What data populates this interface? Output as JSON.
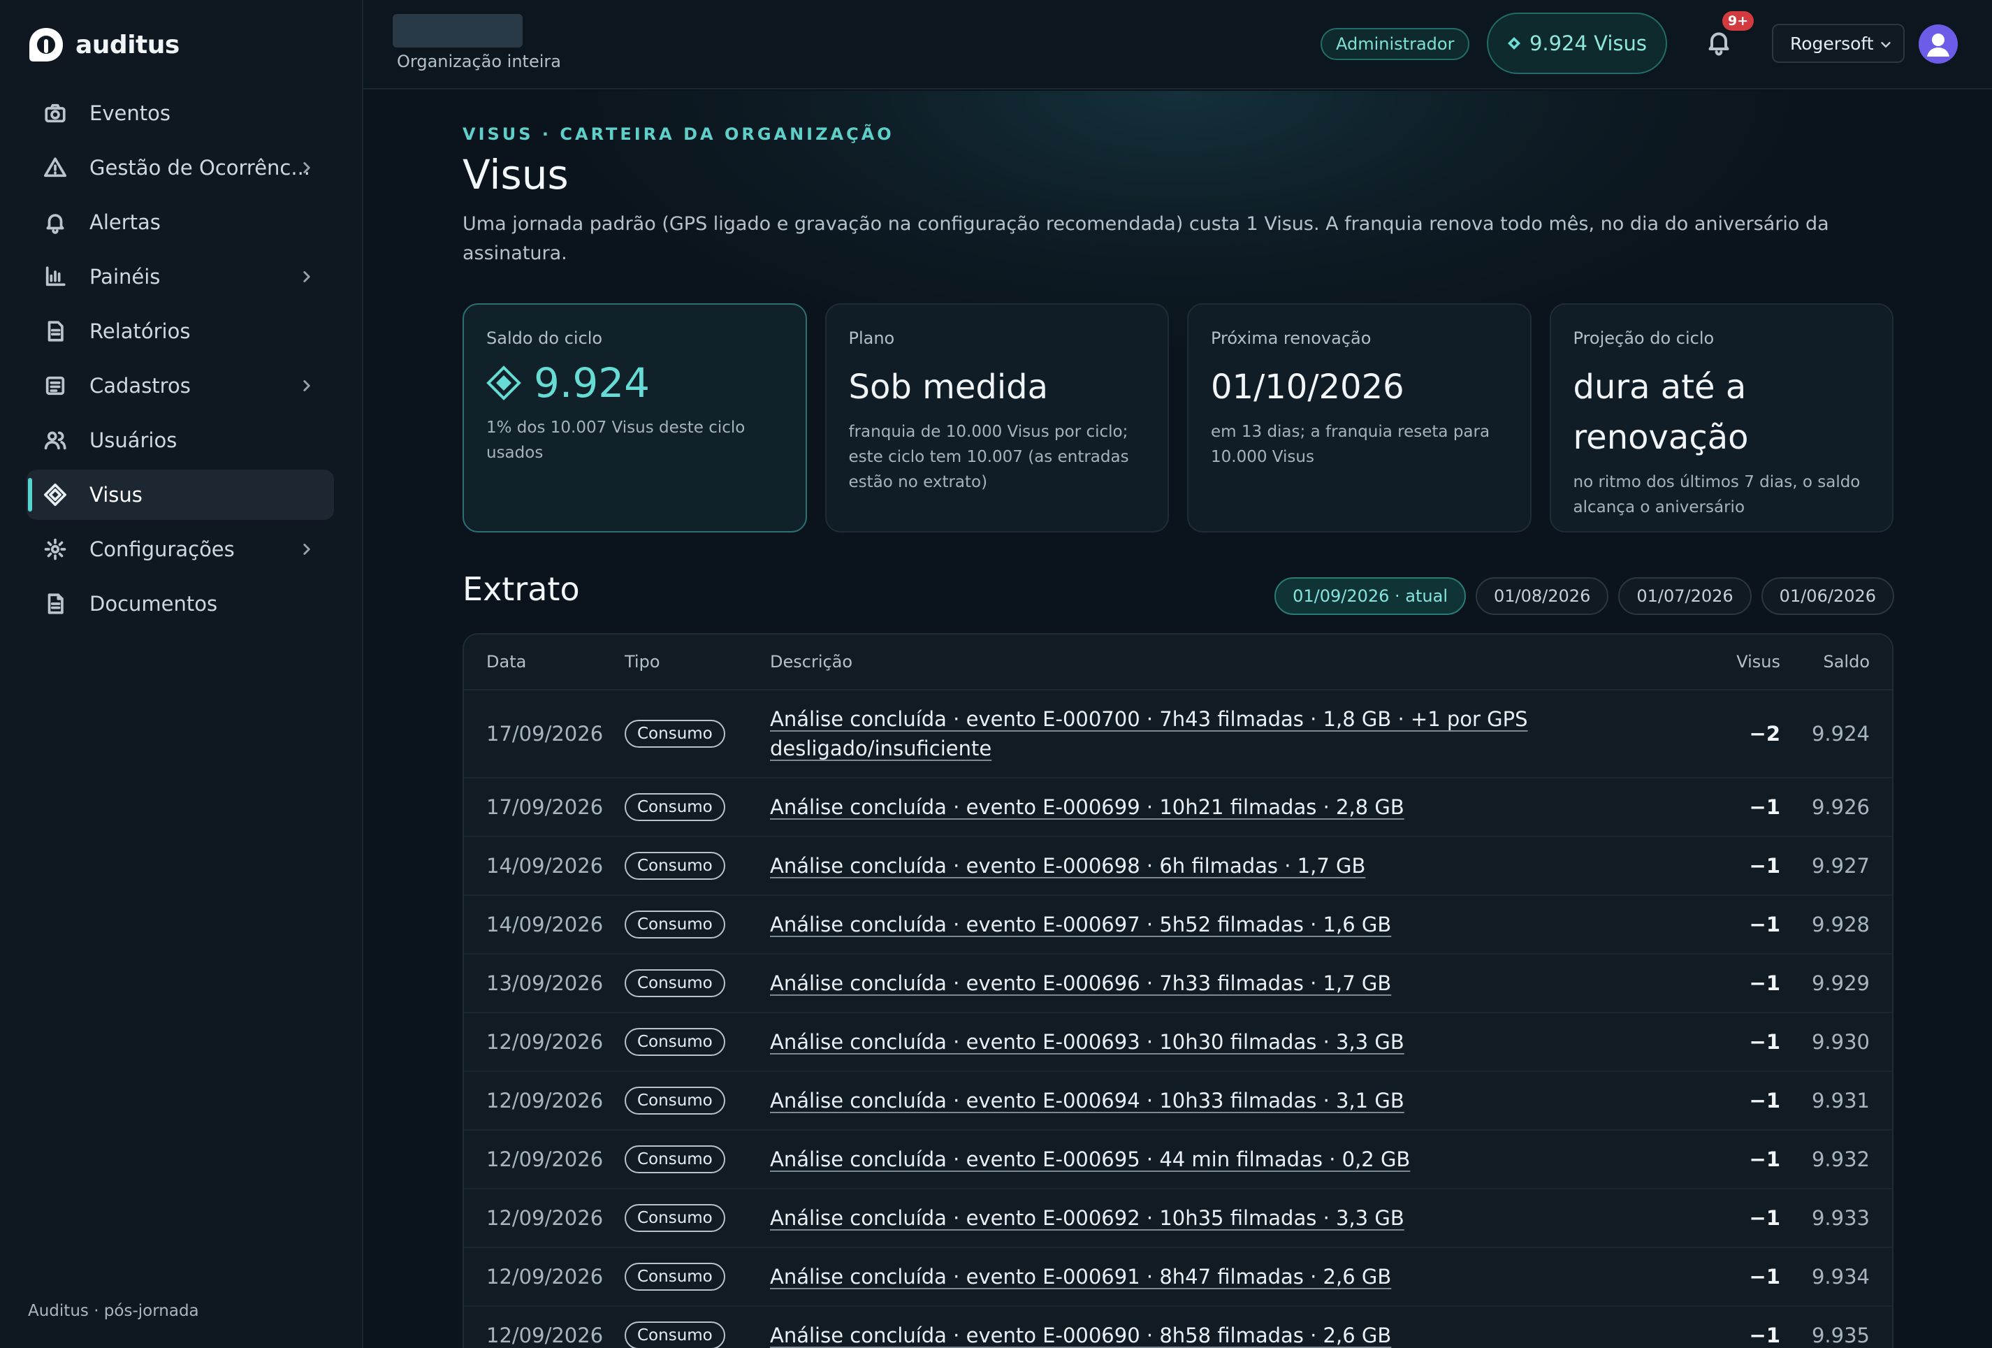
{
  "brand": {
    "name": "auditus"
  },
  "sidebar": {
    "items": [
      {
        "label": "Eventos",
        "icon": "camera-icon",
        "has_children": false,
        "active": false
      },
      {
        "label": "Gestão de Ocorrênc...",
        "icon": "warning-icon",
        "has_children": true,
        "active": false
      },
      {
        "label": "Alertas",
        "icon": "bell-icon",
        "has_children": false,
        "active": false
      },
      {
        "label": "Painéis",
        "icon": "bar-chart-icon",
        "has_children": true,
        "active": false
      },
      {
        "label": "Relatórios",
        "icon": "document-icon",
        "has_children": false,
        "active": false
      },
      {
        "label": "Cadastros",
        "icon": "list-icon",
        "has_children": true,
        "active": false
      },
      {
        "label": "Usuários",
        "icon": "users-icon",
        "has_children": false,
        "active": false
      },
      {
        "label": "Visus",
        "icon": "diamond-icon",
        "has_children": false,
        "active": true
      },
      {
        "label": "Configurações",
        "icon": "gear-icon",
        "has_children": true,
        "active": false
      },
      {
        "label": "Documentos",
        "icon": "file-icon",
        "has_children": false,
        "active": false
      }
    ],
    "footer": "Auditus · pós-jornada"
  },
  "topbar": {
    "org_label": "Organização inteira",
    "role": "Administrador",
    "visus_balance": "9.924 Visus",
    "notifications_badge": "9+",
    "account": "Rogersoft"
  },
  "page": {
    "eyebrow": "VISUS · CARTEIRA DA ORGANIZAÇÃO",
    "title": "Visus",
    "description": "Uma jornada padrão (GPS ligado e gravação na configuração recomendada) custa 1 Visus. A franquia renova todo mês, no dia do aniversário da assinatura."
  },
  "cards": {
    "saldo": {
      "label": "Saldo do ciclo",
      "value": "9.924",
      "sub": "1% dos 10.007 Visus deste ciclo usados"
    },
    "plano": {
      "label": "Plano",
      "value": "Sob medida",
      "sub": "franquia de 10.000 Visus por ciclo; este ciclo tem 10.007 (as entradas estão no extrato)"
    },
    "renovacao": {
      "label": "Próxima renovação",
      "value": "01/10/2026",
      "sub": "em 13 dias; a franquia reseta para 10.000 Visus"
    },
    "projecao": {
      "label": "Projeção do ciclo",
      "value": "dura até a renovação",
      "sub": "no ritmo dos últimos 7 dias, o saldo alcança o aniversário"
    }
  },
  "extrato": {
    "title": "Extrato",
    "cycles": [
      "01/09/2026 · atual",
      "01/08/2026",
      "01/07/2026",
      "01/06/2026"
    ],
    "columns": {
      "date": "Data",
      "type": "Tipo",
      "desc": "Descrição",
      "visus": "Visus",
      "saldo": "Saldo"
    },
    "rows": [
      {
        "date": "17/09/2026",
        "type": "Consumo",
        "desc": "Análise concluída · evento E-000700 · 7h43 filmadas · 1,8 GB · +1 por GPS desligado/insuficiente",
        "visus": "−2",
        "saldo": "9.924"
      },
      {
        "date": "17/09/2026",
        "type": "Consumo",
        "desc": "Análise concluída · evento E-000699 · 10h21 filmadas · 2,8 GB",
        "visus": "−1",
        "saldo": "9.926"
      },
      {
        "date": "14/09/2026",
        "type": "Consumo",
        "desc": "Análise concluída · evento E-000698 · 6h filmadas · 1,7 GB",
        "visus": "−1",
        "saldo": "9.927"
      },
      {
        "date": "14/09/2026",
        "type": "Consumo",
        "desc": "Análise concluída · evento E-000697 · 5h52 filmadas · 1,6 GB",
        "visus": "−1",
        "saldo": "9.928"
      },
      {
        "date": "13/09/2026",
        "type": "Consumo",
        "desc": "Análise concluída · evento E-000696 · 7h33 filmadas · 1,7 GB",
        "visus": "−1",
        "saldo": "9.929"
      },
      {
        "date": "12/09/2026",
        "type": "Consumo",
        "desc": "Análise concluída · evento E-000693 · 10h30 filmadas · 3,3 GB",
        "visus": "−1",
        "saldo": "9.930"
      },
      {
        "date": "12/09/2026",
        "type": "Consumo",
        "desc": "Análise concluída · evento E-000694 · 10h33 filmadas · 3,1 GB",
        "visus": "−1",
        "saldo": "9.931"
      },
      {
        "date": "12/09/2026",
        "type": "Consumo",
        "desc": "Análise concluída · evento E-000695 · 44 min filmadas · 0,2 GB",
        "visus": "−1",
        "saldo": "9.932"
      },
      {
        "date": "12/09/2026",
        "type": "Consumo",
        "desc": "Análise concluída · evento E-000692 · 10h35 filmadas · 3,3 GB",
        "visus": "−1",
        "saldo": "9.933"
      },
      {
        "date": "12/09/2026",
        "type": "Consumo",
        "desc": "Análise concluída · evento E-000691 · 8h47 filmadas · 2,6 GB",
        "visus": "−1",
        "saldo": "9.934"
      },
      {
        "date": "12/09/2026",
        "type": "Consumo",
        "desc": "Análise concluída · evento E-000690 · 8h58 filmadas · 2,6 GB",
        "visus": "−1",
        "saldo": "9.935"
      }
    ]
  },
  "colors": {
    "accent": "#5fd0c9",
    "background": "#0b141c",
    "badge": "#d33a40",
    "avatar": "#6c5ce7"
  }
}
